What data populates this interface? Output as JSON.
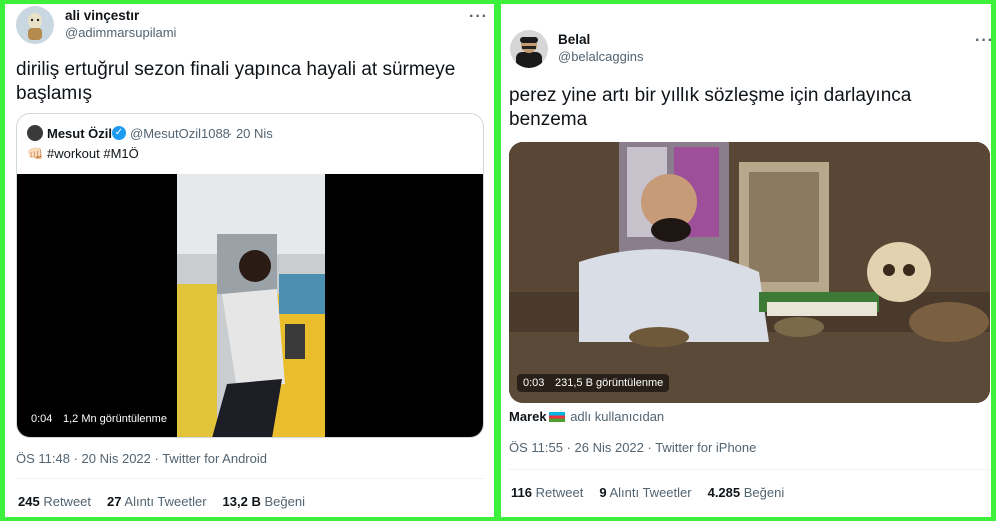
{
  "left": {
    "user": {
      "name": "ali vinçestır",
      "handle": "@adimmarsupilami"
    },
    "more": "···",
    "text": "diriliş ertuğrul sezon finali yapınca hayali at sürmeye başlamış",
    "quote": {
      "name": "Mesut Özil",
      "verified": "✓",
      "handle": "@MesutOzil1088",
      "date": "· 20 Nis",
      "emoji": "👊🏻",
      "text": "#workout #M1Ö",
      "video": {
        "time": "0:04",
        "views": "1,2 Mn görüntülenme"
      }
    },
    "timestamp": "ÖS 11:48 · 20 Nis 2022 · Twitter for Android",
    "stats": {
      "retweets": "245",
      "retweets_label": "Retweet",
      "quotes": "27",
      "quotes_label": "Alıntı Tweetler",
      "likes": "13,2 B",
      "likes_label": "Beğeni"
    }
  },
  "right": {
    "user": {
      "name": "Belal",
      "handle": "@belalcaggins"
    },
    "more": "···",
    "text": "perez yine artı bir yıllık sözleşme için darlayınca benzema",
    "video": {
      "time": "0:03",
      "views": "231,5 B görüntülenme"
    },
    "attribution": {
      "name": "Marek",
      "suffix": "adlı kullanıcıdan"
    },
    "timestamp": "ÖS 11:55 · 26 Nis 2022 · Twitter for iPhone",
    "stats": {
      "retweets": "116",
      "retweets_label": "Retweet",
      "quotes": "9",
      "quotes_label": "Alıntı Tweetler",
      "likes": "4.285",
      "likes_label": "Beğeni"
    }
  },
  "colors": {
    "border": "#3cf03c",
    "verified": "#1d9bf0",
    "muted": "#536471"
  }
}
